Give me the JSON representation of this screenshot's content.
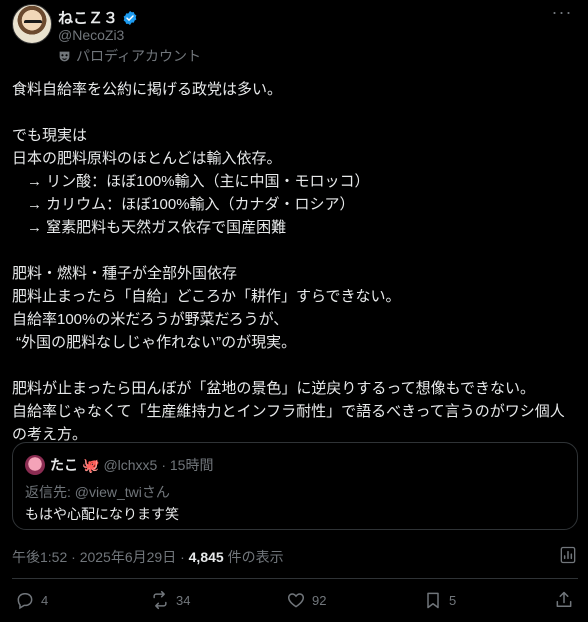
{
  "tweet": {
    "display_name": "ねこＺ３",
    "handle": "@NecoZi3",
    "parody_label": "パロディアカウント",
    "body": "食料自給率を公約に掲げる政党は多い。\n\nでも現実は\n日本の肥料原料のほとんどは輸入依存。\n　→ リン酸：ほぼ100%輸入（主に中国・モロッコ）\n　→ カリウム：ほぼ100%輸入（カナダ・ロシア）\n　→ 窒素肥料も天然ガス依存で国産困難\n\n肥料・燃料・種子が全部外国依存\n肥料止まったら「自給」どころか「耕作」すらできない。\n自給率100%の米だろうが野菜だろうが、\n “外国の肥料なしじゃ作れない”のが現実。\n\n肥料が止まったら田んぼが「盆地の景色」に逆戻りするって想像もできない。\n自給率じゃなくて「生産維持力とインフラ耐性」で語るべきって言うのがワシ個人の考え方。",
    "timestamp": "午後1:52 · 2025年6月29日 · ",
    "views_count": "4,845",
    "views_label": " 件の表示"
  },
  "quote": {
    "display_name": "たこ",
    "emoji": "🐙",
    "handle": "@lchxx5",
    "time": " · 15時間",
    "reply_to": "返信先: @view_twiさん",
    "text": "もはや心配になります笑"
  },
  "actions": {
    "replies": "4",
    "reposts": "34",
    "likes": "92",
    "bookmarks": "5"
  },
  "icons": {
    "verified": "verified-badge-icon",
    "parody": "parody-mask-icon",
    "more": "more-dots-icon",
    "analytics": "analytics-icon",
    "reply": "reply-bubble-icon",
    "repost": "repost-icon",
    "like": "heart-icon",
    "bookmark": "bookmark-icon",
    "share": "share-icon"
  },
  "colors": {
    "background": "#000000",
    "text": "#e7e9ea",
    "muted": "#71767b",
    "border": "#2f3336",
    "verified": "#1d9bf0"
  }
}
